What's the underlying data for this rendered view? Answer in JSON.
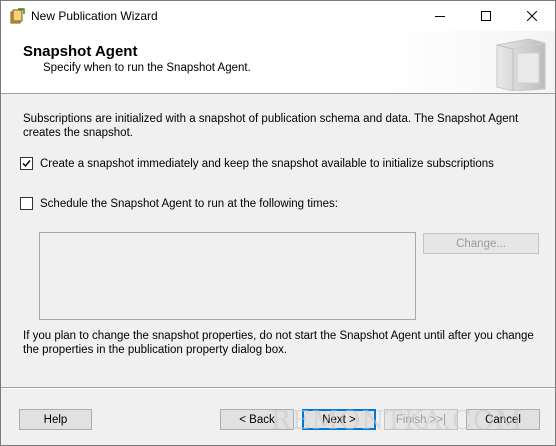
{
  "window": {
    "title": "New Publication Wizard",
    "minimize_icon": "minimize-icon",
    "maximize_icon": "maximize-icon",
    "close_icon": "close-icon"
  },
  "header": {
    "title": "Snapshot Agent",
    "subtitle": "Specify when to run the Snapshot Agent."
  },
  "intro_text": "Subscriptions are initialized with a snapshot of publication schema and data. The Snapshot Agent creates the snapshot.",
  "options": [
    {
      "label": "Create a snapshot immediately and keep the snapshot available to initialize subscriptions",
      "checked": true
    },
    {
      "label": "Schedule the Snapshot Agent to run at the following times:",
      "checked": false
    }
  ],
  "change_button": "Change...",
  "note_text": "If you plan to change the snapshot properties, do not start the Snapshot Agent until after you change the properties in the publication property dialog box.",
  "buttons": {
    "help": "Help",
    "back": "< Back",
    "next": "Next >",
    "finish": "Finish >>|",
    "cancel": "Cancel"
  },
  "watermark": "REMONTKA.COM"
}
